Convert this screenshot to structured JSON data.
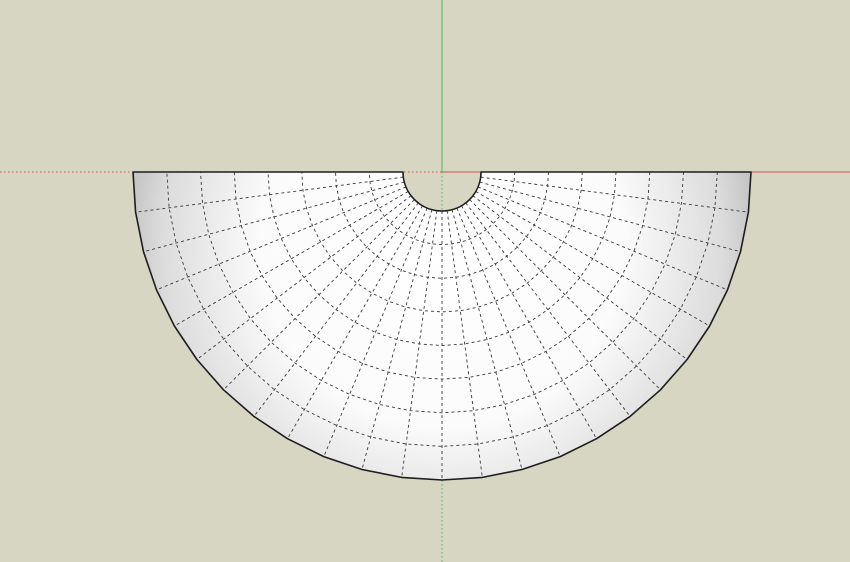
{
  "viewport": {
    "background": "#d6d6c2",
    "model_fill_center": "#ffffff",
    "model_fill_edge": "#b9b9b9",
    "edge_color": "#1e1e1e",
    "hidden_edge_color": "#3a3a3a"
  },
  "axes": {
    "red_axis_color": "#d2544c",
    "green_axis_color": "#58b058"
  },
  "model": {
    "shape": "half-dome-with-notch",
    "radial_segments": 24,
    "ring_count": 8,
    "hidden_edges_shown": true
  }
}
